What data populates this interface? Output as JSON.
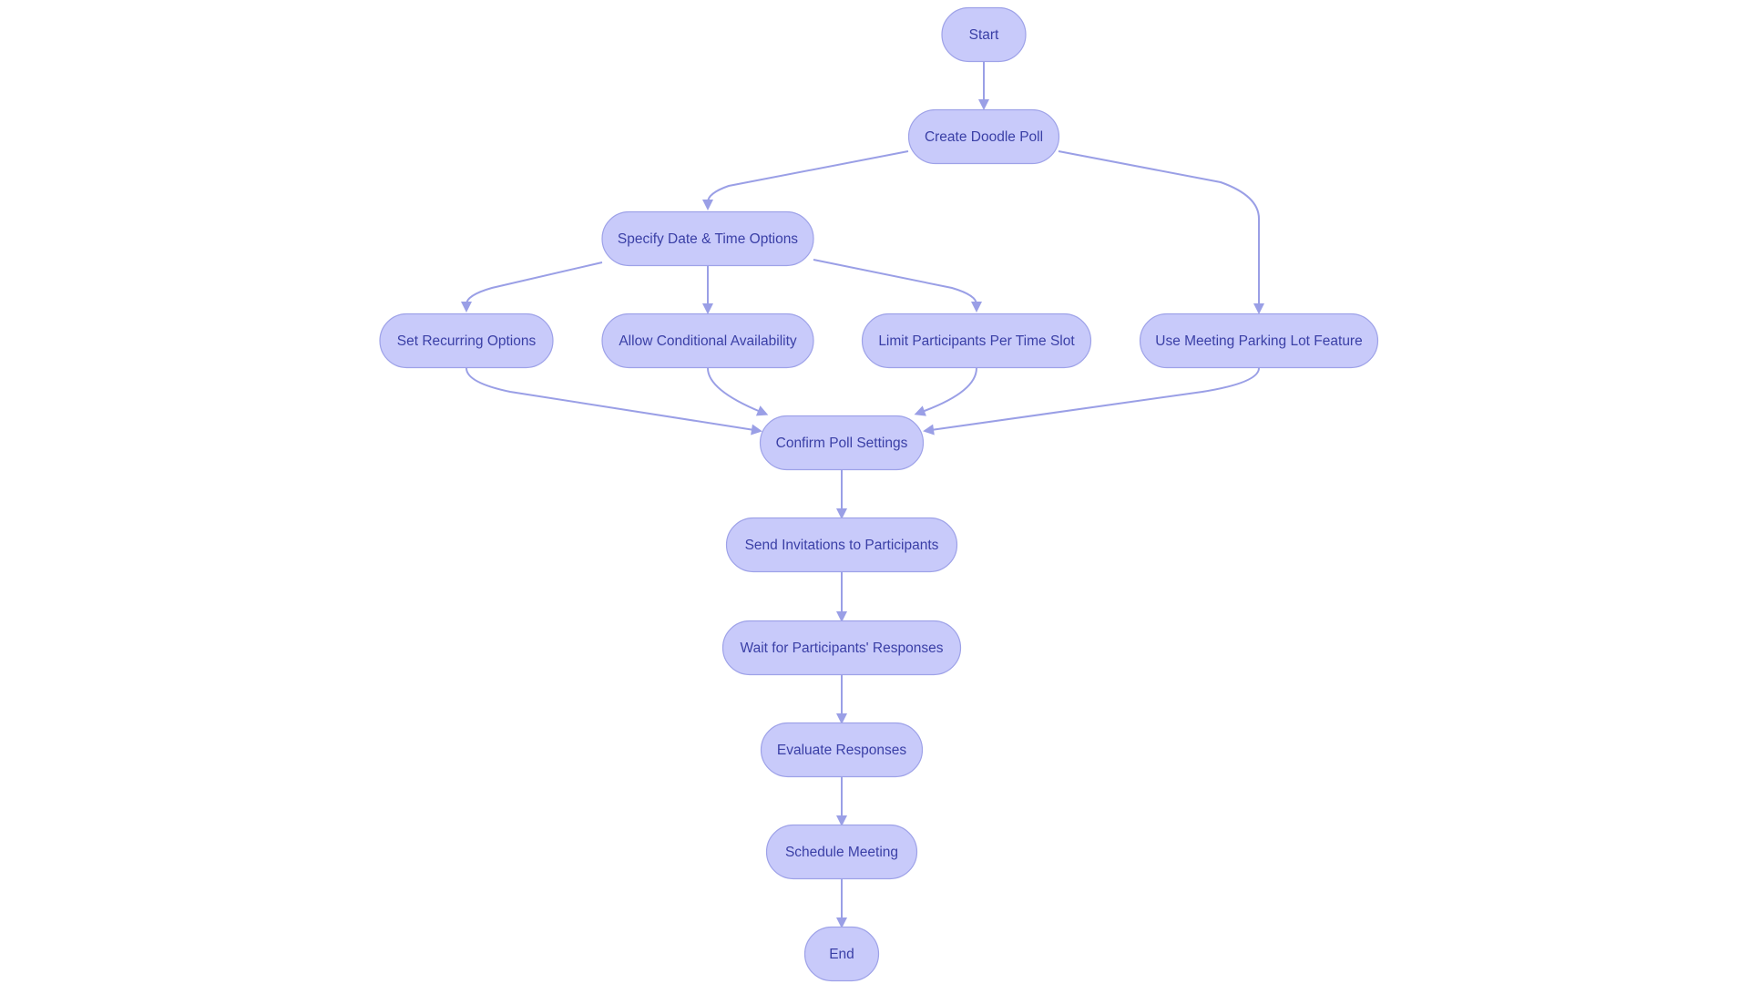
{
  "diagram": {
    "type": "flowchart",
    "colors": {
      "node_fill": "#c8cafa",
      "node_border": "#9ea2e8",
      "text": "#3a3fa6",
      "edge": "#9a9fe6"
    },
    "nodes": [
      {
        "id": "start",
        "label": "Start"
      },
      {
        "id": "create",
        "label": "Create Doodle Poll"
      },
      {
        "id": "specify",
        "label": "Specify Date & Time Options"
      },
      {
        "id": "recurring",
        "label": "Set Recurring Options"
      },
      {
        "id": "conditional",
        "label": "Allow Conditional Availability"
      },
      {
        "id": "limit",
        "label": "Limit Participants Per Time Slot"
      },
      {
        "id": "parking",
        "label": "Use Meeting Parking Lot Feature"
      },
      {
        "id": "confirm",
        "label": "Confirm Poll Settings"
      },
      {
        "id": "send",
        "label": "Send Invitations to Participants"
      },
      {
        "id": "wait",
        "label": "Wait for Participants' Responses"
      },
      {
        "id": "evaluate",
        "label": "Evaluate Responses"
      },
      {
        "id": "schedule",
        "label": "Schedule Meeting"
      },
      {
        "id": "end",
        "label": "End"
      }
    ],
    "edges": [
      {
        "from": "start",
        "to": "create"
      },
      {
        "from": "create",
        "to": "specify"
      },
      {
        "from": "create",
        "to": "parking"
      },
      {
        "from": "specify",
        "to": "recurring"
      },
      {
        "from": "specify",
        "to": "conditional"
      },
      {
        "from": "specify",
        "to": "limit"
      },
      {
        "from": "recurring",
        "to": "confirm"
      },
      {
        "from": "conditional",
        "to": "confirm"
      },
      {
        "from": "limit",
        "to": "confirm"
      },
      {
        "from": "parking",
        "to": "confirm"
      },
      {
        "from": "confirm",
        "to": "send"
      },
      {
        "from": "send",
        "to": "wait"
      },
      {
        "from": "wait",
        "to": "evaluate"
      },
      {
        "from": "evaluate",
        "to": "schedule"
      },
      {
        "from": "schedule",
        "to": "end"
      }
    ]
  }
}
